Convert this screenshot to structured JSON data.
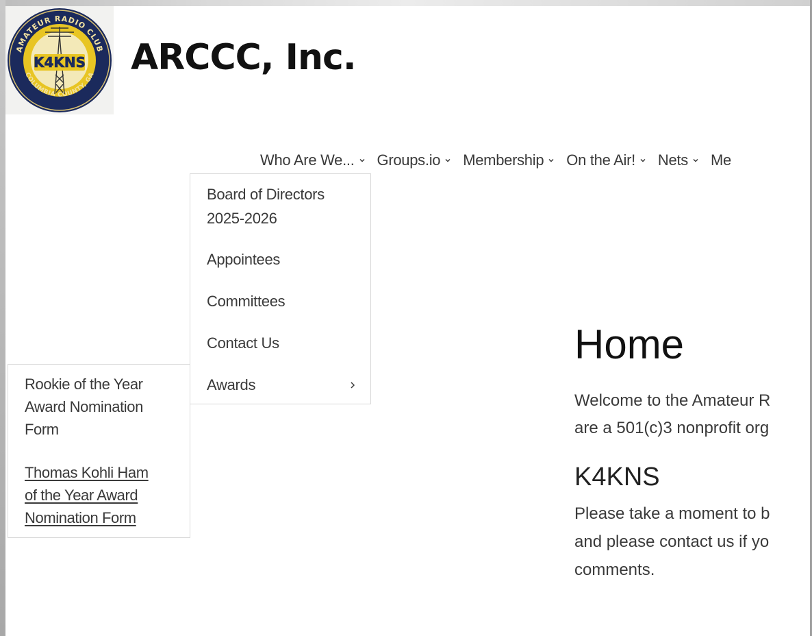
{
  "site": {
    "title": "ARCCC, Inc.",
    "logo": {
      "callsign": "K4KNS",
      "top_text": "AMATEUR RADIO CLUB",
      "bottom_text": "COLUMBIA COUNTY, GA",
      "icon": "antenna-tower-icon"
    }
  },
  "nav": {
    "items": [
      {
        "label": "Who Are We...",
        "icon": "chevron-down-icon"
      },
      {
        "label": "Groups.io",
        "icon": "chevron-down-icon"
      },
      {
        "label": "Membership",
        "icon": "chevron-down-icon"
      },
      {
        "label": "On the Air!",
        "icon": "chevron-down-icon"
      },
      {
        "label": "Nets",
        "icon": "chevron-down-icon"
      },
      {
        "label": "Me"
      }
    ]
  },
  "submenu": {
    "items": [
      {
        "label_line1": "Board of Directors",
        "label_line2": "2025-2026"
      },
      {
        "label": "Appointees"
      },
      {
        "label": "Committees"
      },
      {
        "label": "Contact Us"
      },
      {
        "label": "Awards",
        "icon": "chevron-right-icon"
      }
    ]
  },
  "awards_flyout": {
    "items": [
      {
        "lines": [
          "Rookie of the Year",
          "Award Nomination",
          "Form"
        ]
      },
      {
        "lines": [
          "Thomas Kohli Ham",
          "of the Year Award",
          "Nomination Form"
        ]
      }
    ]
  },
  "content": {
    "heading": "Home",
    "welcome_lines": [
      "Welcome to the Amateur R",
      "are a 501(c)3 nonprofit org"
    ],
    "subheading": "K4KNS",
    "intro_lines": [
      "Please take a moment to b",
      "and please contact us if yo",
      "comments."
    ]
  },
  "colors": {
    "logo_navy": "#1b2a5c",
    "logo_gold": "#e8c523",
    "text_dark": "#111111",
    "text_body": "#3a3a3a",
    "border": "#d8d8d8"
  }
}
